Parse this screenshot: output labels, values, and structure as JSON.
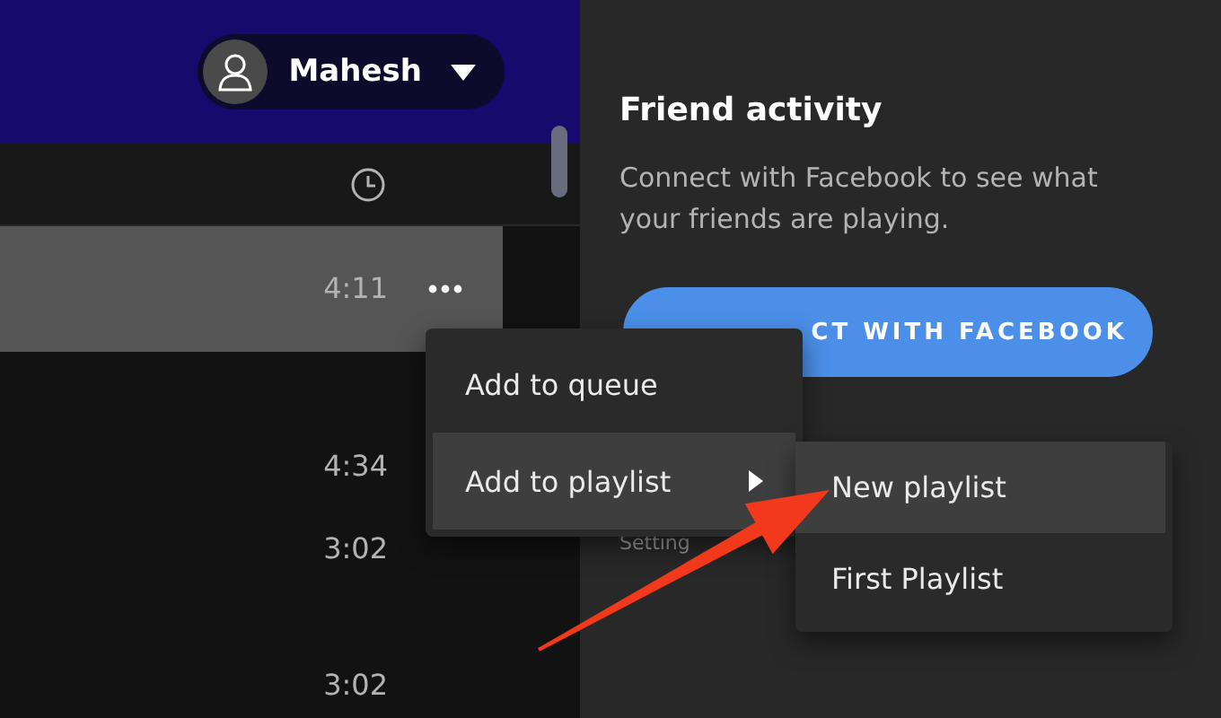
{
  "header": {
    "user": {
      "name": "Mahesh"
    }
  },
  "tracklist": {
    "rows": [
      {
        "duration": "4:11",
        "selected": true
      },
      {
        "duration": "4:34",
        "selected": false
      },
      {
        "duration": "3:02",
        "selected": false
      },
      {
        "duration": "3:02",
        "selected": false
      }
    ]
  },
  "friend_activity": {
    "title": "Friend activity",
    "description": "Connect with Facebook to see what your friends are playing.",
    "button": "CT WITH FACEBOOK",
    "settings_link": "Setting"
  },
  "context_menu": {
    "items": [
      {
        "label": "Add to queue",
        "selected": false,
        "has_submenu": false
      },
      {
        "label": "Add to playlist",
        "selected": true,
        "has_submenu": true
      }
    ]
  },
  "submenu": {
    "items": [
      {
        "label": "New playlist",
        "selected": true
      },
      {
        "label": "First Playlist",
        "selected": false
      }
    ]
  }
}
